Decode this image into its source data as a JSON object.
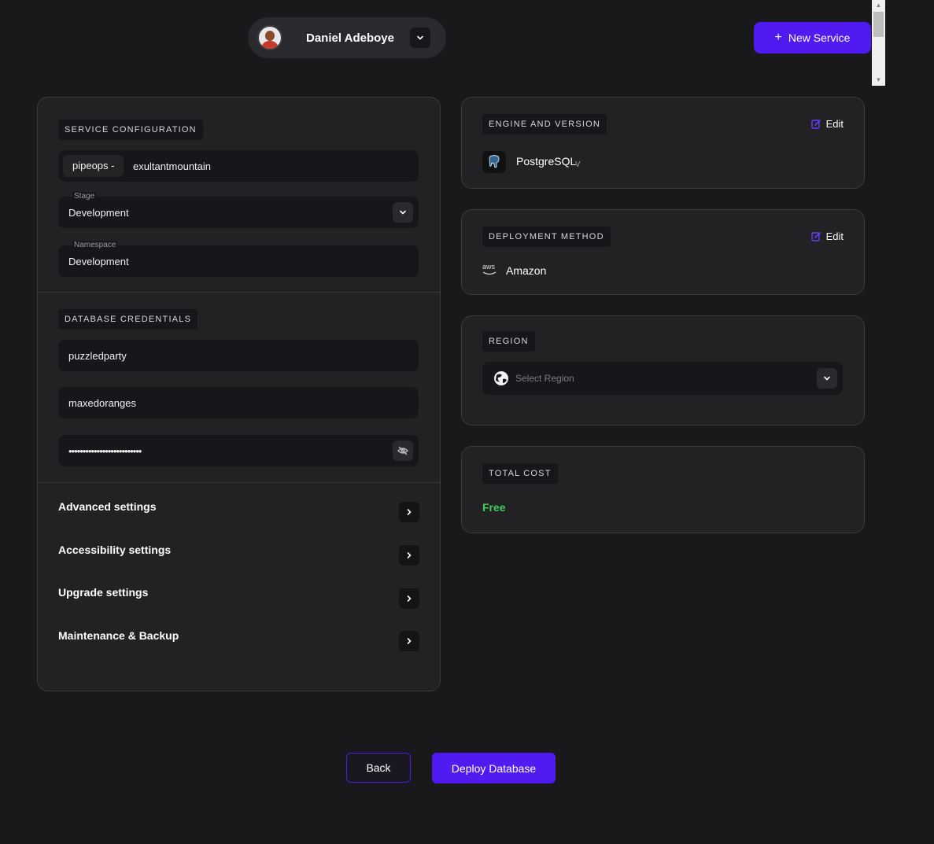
{
  "header": {
    "user_name": "Daniel Adeboye",
    "new_service_label": "New Service",
    "new_service_icon": "plus-icon"
  },
  "service_config": {
    "section_title": "SERVICE CONFIGURATION",
    "name_prefix": "pipeops -",
    "name_value": "exultantmountain",
    "stage_label": "Stage",
    "stage_value": "Development",
    "namespace_label": "Namespace",
    "namespace_value": "Development"
  },
  "credentials": {
    "section_title": "DATABASE CREDENTIALS",
    "database_name": "puzzledparty",
    "username": "maxedoranges",
    "password_masked": "••••••••••••••••••••••••••"
  },
  "settings": [
    {
      "label": "Advanced settings"
    },
    {
      "label": "Accessibility settings"
    },
    {
      "label": "Upgrade settings"
    },
    {
      "label": "Maintenance & Backup"
    }
  ],
  "engine": {
    "section_title": "ENGINE AND VERSION",
    "edit_label": "Edit",
    "engine_name": "PostgreSQL",
    "version_prefix": "v"
  },
  "deployment": {
    "section_title": "DEPLOYMENT METHOD",
    "edit_label": "Edit",
    "provider_logo_text": "aws",
    "provider_name": "Amazon"
  },
  "region": {
    "section_title": "REGION",
    "placeholder": "Select Region"
  },
  "cost": {
    "section_title": "TOTAL COST",
    "value": "Free",
    "value_color": "#3ecf5c"
  },
  "footer": {
    "back_label": "Back",
    "deploy_label": "Deploy Database"
  },
  "colors": {
    "accent": "#4f1bf0",
    "background": "#19181b",
    "panel": "#222225"
  }
}
